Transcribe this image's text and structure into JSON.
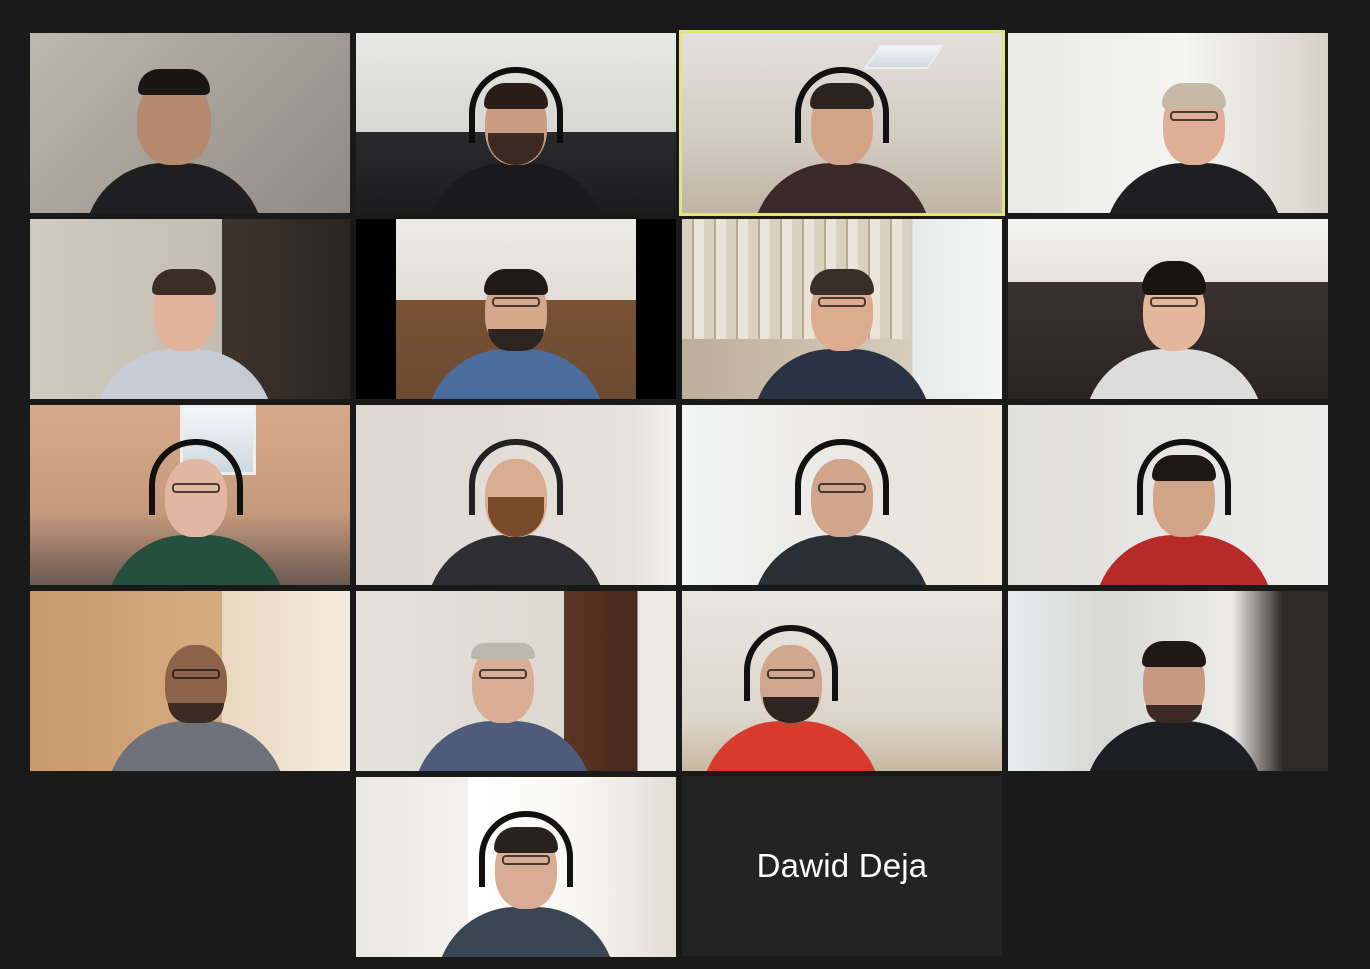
{
  "meeting": {
    "layout": "gallery-view",
    "active_speaker_border_color": "#e3e57a",
    "background_color": "#1a1a1a"
  },
  "participants": [
    {
      "name_shown": "",
      "video": "on"
    },
    {
      "name_shown": "",
      "video": "on"
    },
    {
      "name_shown": "",
      "video": "on",
      "active_speaker": true
    },
    {
      "name_shown": "",
      "video": "on"
    },
    {
      "name_shown": "",
      "video": "on"
    },
    {
      "name_shown": "",
      "video": "on"
    },
    {
      "name_shown": "",
      "video": "on"
    },
    {
      "name_shown": "",
      "video": "on"
    },
    {
      "name_shown": "",
      "video": "on"
    },
    {
      "name_shown": "",
      "video": "on"
    },
    {
      "name_shown": "",
      "video": "on"
    },
    {
      "name_shown": "",
      "video": "on"
    },
    {
      "name_shown": "",
      "video": "on"
    },
    {
      "name_shown": "",
      "video": "on"
    },
    {
      "name_shown": "",
      "video": "on"
    },
    {
      "name_shown": "",
      "video": "on"
    },
    {
      "name_shown": "",
      "video": "on"
    },
    {
      "name_shown": "Dawid Deja",
      "video": "off"
    }
  ]
}
